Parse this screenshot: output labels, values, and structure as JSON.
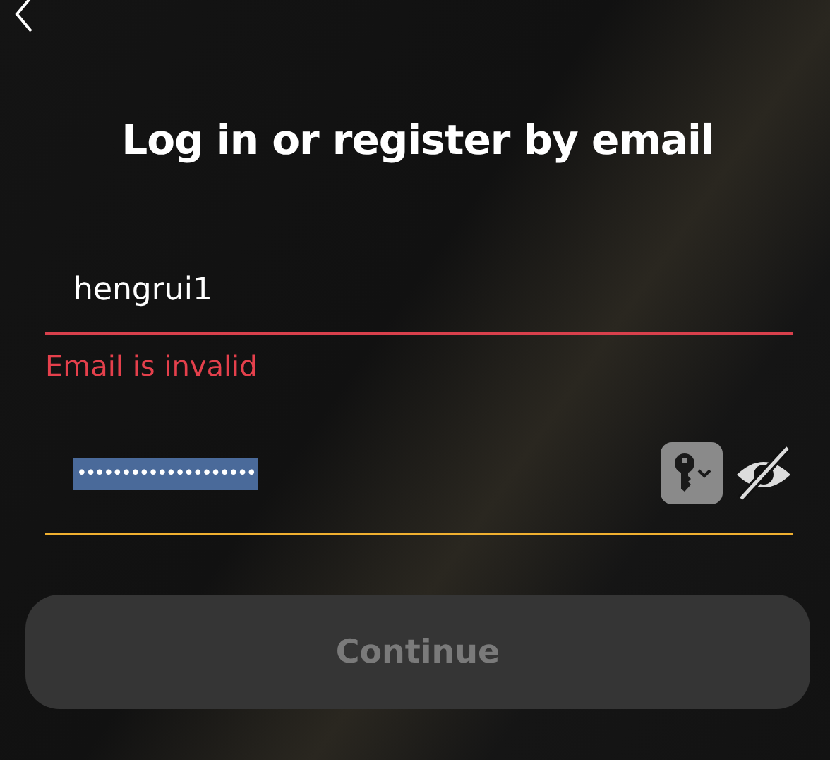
{
  "title": "Log in or register by email",
  "email_field": {
    "value": "hengrui1",
    "invalid": true,
    "error": "Email is invalid"
  },
  "password_field": {
    "value": "••••••••••••••••••••",
    "text_selected": true,
    "focused": true
  },
  "continue_button": {
    "label": "Continue",
    "disabled": true
  }
}
